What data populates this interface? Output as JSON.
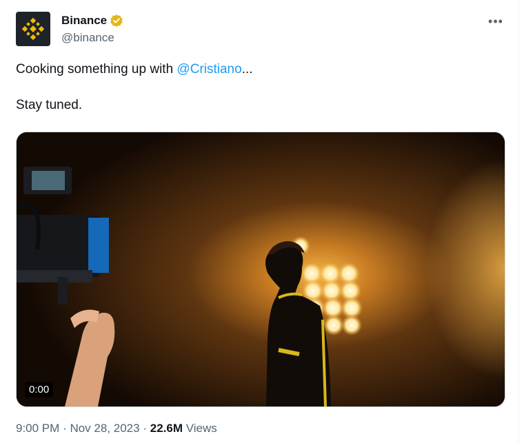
{
  "author": {
    "display_name": "Binance",
    "handle": "@binance",
    "verified": true,
    "verified_badge_color": "#e2b719",
    "avatar_icon": "binance-logo-icon",
    "brand_color": "#f0b90b"
  },
  "menu": {
    "icon": "more-dots-icon",
    "glyph": "•••"
  },
  "tweet": {
    "text_before_mention": "Cooking something up with ",
    "mention": "@Cristiano",
    "text_after_mention": "...",
    "second_line": "Stay tuned.",
    "mention_color": "#1d9bf0"
  },
  "media": {
    "type": "video",
    "timecode": "0:00"
  },
  "meta": {
    "time": "9:00 PM",
    "separator": "·",
    "date": "Nov 28, 2023",
    "views_count": "22.6M",
    "views_label": "Views"
  }
}
